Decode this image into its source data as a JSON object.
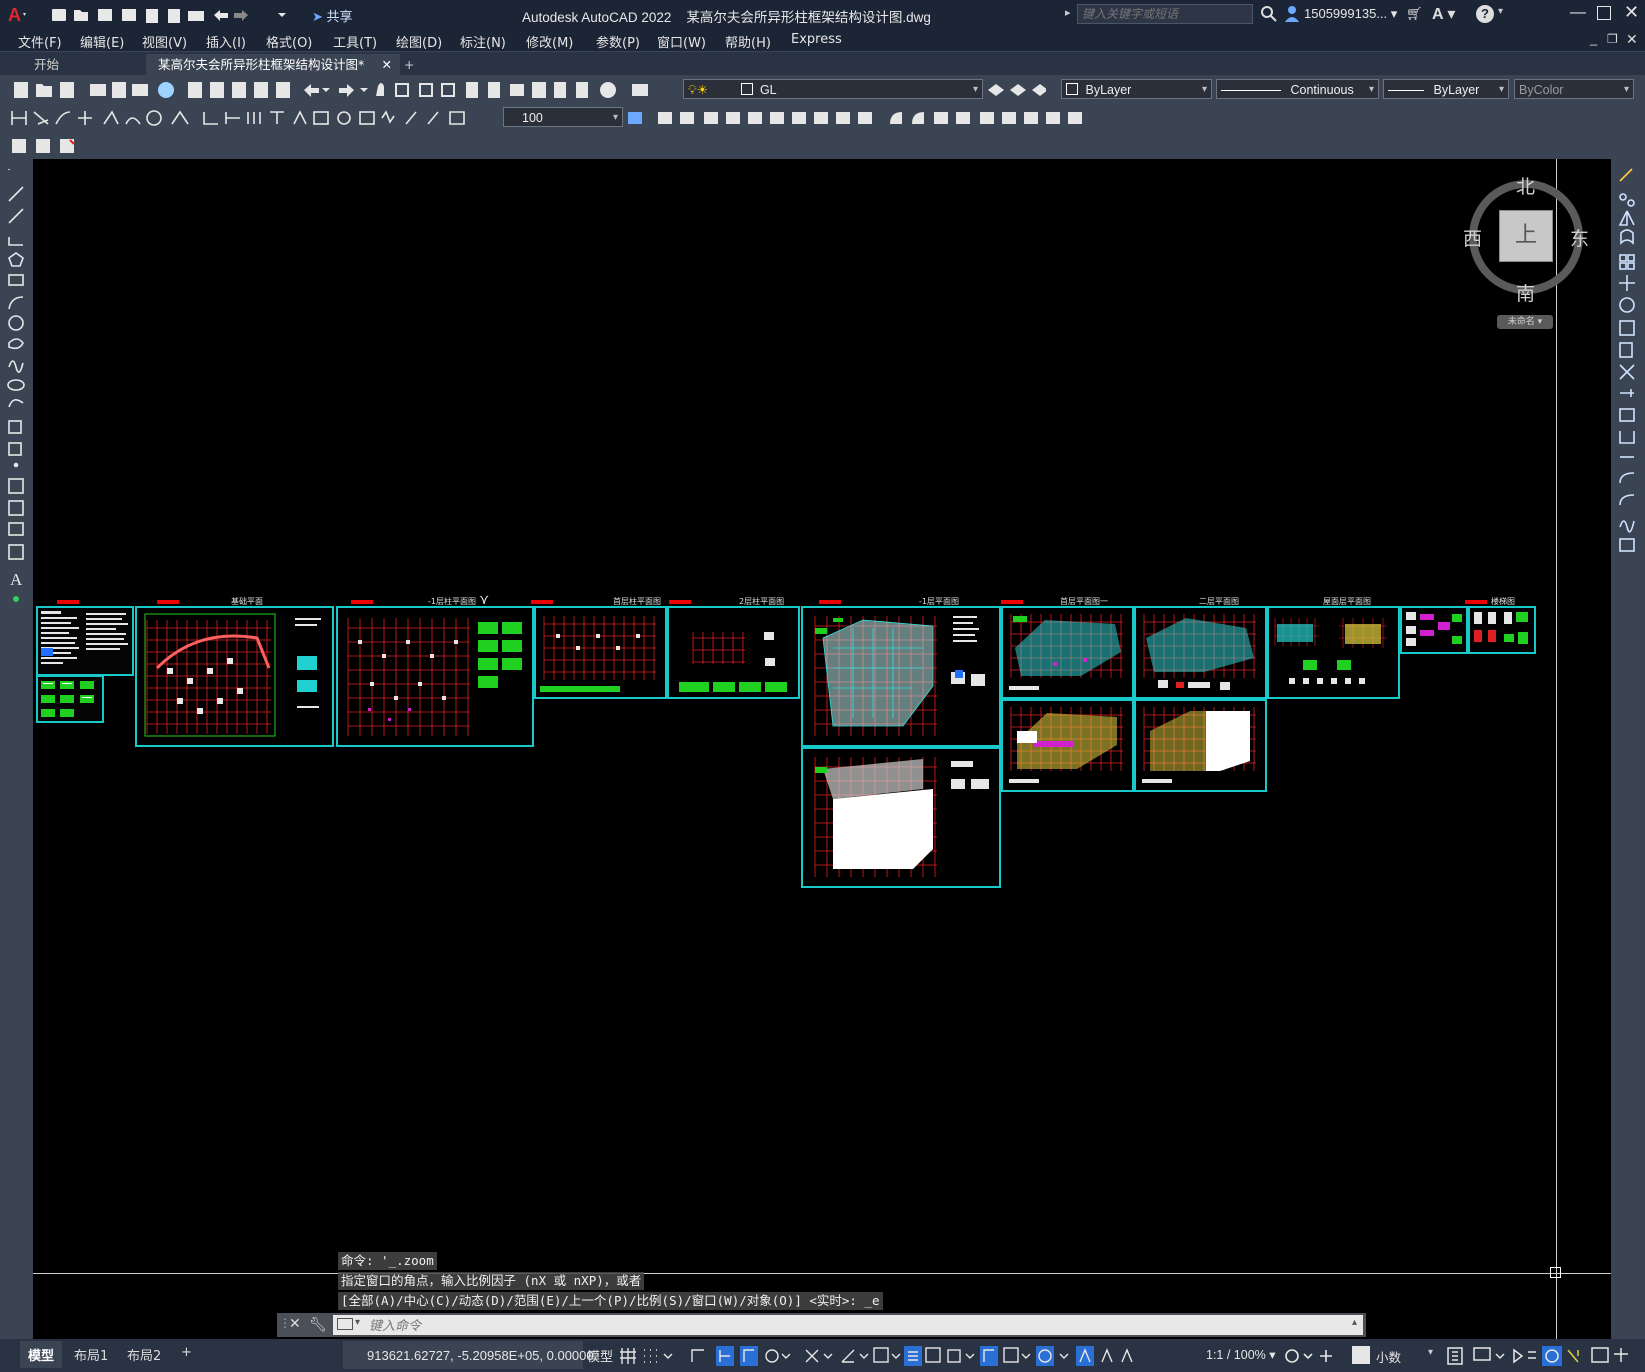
{
  "app": {
    "title": "Autodesk AutoCAD 2022",
    "filename": "某高尔夫会所异形柱框架结构设计图.dwg",
    "share_label": "共享",
    "search_placeholder": "键入关键字或短语",
    "user": "1505999135...",
    "help": "?"
  },
  "menu": [
    "文件(F)",
    "编辑(E)",
    "视图(V)",
    "插入(I)",
    "格式(O)",
    "工具(T)",
    "绘图(D)",
    "标注(N)",
    "修改(M)",
    "参数(P)",
    "窗口(W)",
    "帮助(H)",
    "Express"
  ],
  "tabs": {
    "start": "开始",
    "document": "某高尔夫会所异形柱框架结构设计图*",
    "add": "+"
  },
  "toolbar": {
    "layer": "GL",
    "color": "ByLayer",
    "linetype": "Continuous",
    "lineweight": "ByLayer",
    "plotstyle": "ByColor",
    "dimscale": "100"
  },
  "viewcube": {
    "north": "北",
    "south": "南",
    "east": "东",
    "west": "西",
    "face": "上",
    "wcs": "未命名"
  },
  "command": {
    "history": [
      "命令: '_.zoom",
      "指定窗口的角点，输入比例因子 (nX 或 nXP)，或者",
      "[全部(A)/中心(C)/动态(D)/范围(E)/上一个(P)/比例(S)/窗口(W)/对象(O)] <实时>: _e"
    ],
    "input_placeholder": "键入命令"
  },
  "status": {
    "layout_tabs": [
      "模型",
      "布局1",
      "布局2"
    ],
    "add_layout": "+",
    "coordinates": "913621.62727, -5.20958E+05, 0.00000",
    "space": "模型",
    "scale": "1:1 / 100%",
    "units": "小数"
  },
  "sheets": [
    {
      "title": "基础平面"
    },
    {
      "title": "-1层柱平面图"
    },
    {
      "title": "首层柱平面图"
    },
    {
      "title": "2层柱平面图"
    },
    {
      "title": "-1层平面图"
    },
    {
      "title": "首层平面图一"
    },
    {
      "title": "二层平面图"
    },
    {
      "title": "屋面层平面图"
    },
    {
      "title": "楼梯图"
    }
  ],
  "colors": {
    "titlebar": "#1c2536",
    "toolbar": "#3b4453",
    "canvas": "#000000",
    "sheet_border": "#19c8c8",
    "drawing_red": "#e02020",
    "drawing_green": "#20d020",
    "drawing_cyan": "#30e0e0"
  }
}
